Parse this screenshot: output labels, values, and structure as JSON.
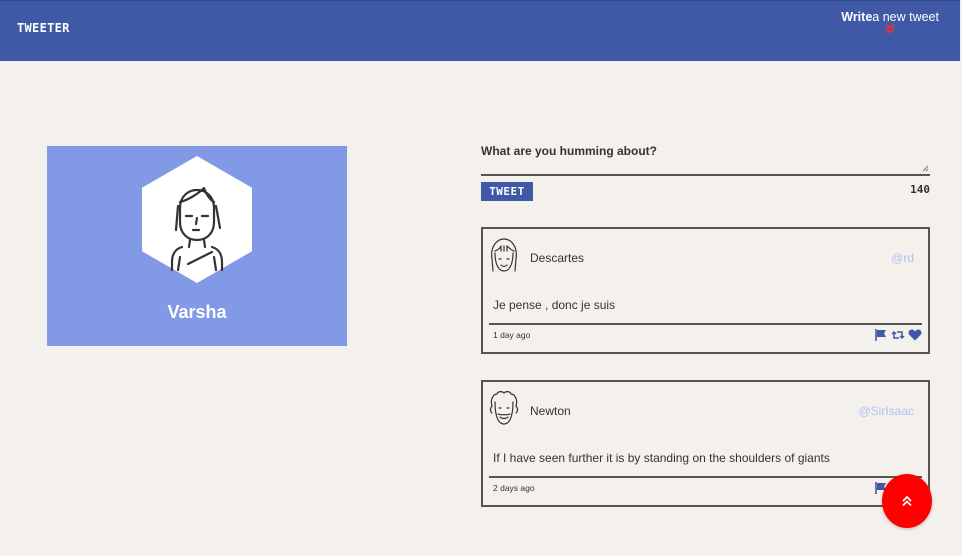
{
  "brand": "TWEETER",
  "nav": {
    "write_bold": "Write",
    "write_rest": "a new tweet"
  },
  "profile": {
    "name": "Varsha"
  },
  "compose": {
    "label": "What are you humming about?",
    "button": "TWEET",
    "remaining": "140"
  },
  "tweets": [
    {
      "author": "Descartes",
      "handle": "@rd",
      "content": "Je pense , donc je suis",
      "time": "1 day ago"
    },
    {
      "author": "Newton",
      "handle": "@SirIsaac",
      "content": "If I have seen further it is by standing on the shoulders of giants",
      "time": "2 days ago"
    }
  ],
  "icons": {
    "flag": "flag-icon",
    "retweet": "retweet-icon",
    "like": "heart-icon",
    "scroll_top": "double-chevron-up-icon"
  },
  "colors": {
    "navbar": "#4059a6",
    "profile_card": "#8299e6",
    "fab": "#ff0000",
    "handle": "#b3bff0"
  }
}
